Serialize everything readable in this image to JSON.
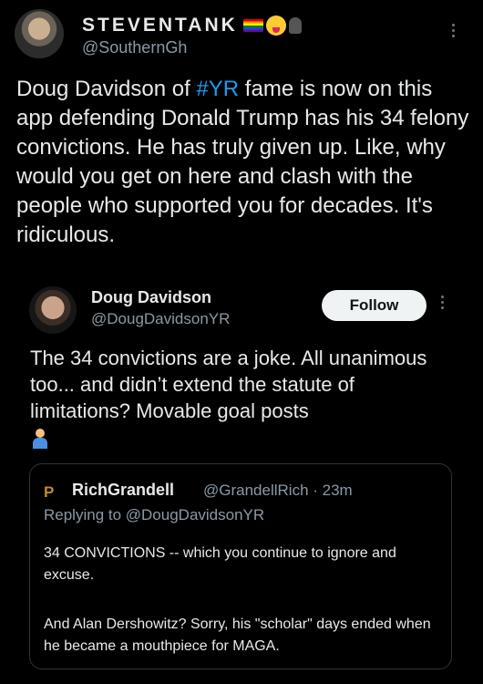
{
  "post": {
    "display_name": "STEVENTANK",
    "handle": "@SouthernGh",
    "text_before_hashtag": "Doug Davidson of ",
    "hashtag": "#YR",
    "text_after_hashtag": " fame is now on this app defending Donald Trump has his 34 felony convictions. He has truly given up. Like, why would you get on here and clash with the people who supported you for decades. It's ridiculous."
  },
  "reply": {
    "display_name": "Doug Davidson",
    "handle": "@DougDavidsonYR",
    "follow_label": "Follow",
    "text": "The 34 convictions are a joke. All unanimous too... and didn’t extend the statute of limitations? Movable goal posts"
  },
  "quoted": {
    "avatar_letter": "P",
    "display_name": "RichGrandell",
    "handle_time": "@GrandellRich · 23m",
    "replying_to": "Replying to @DougDavidsonYR",
    "paragraph1": "34 CONVICTIONS -- which you continue to ignore and excuse.",
    "paragraph2": "And Alan Dershowitz? Sorry, his \"scholar\" days ended when he became a mouthpiece for MAGA."
  },
  "icons": {
    "emoji_flag": "rainbow-flag-icon",
    "emoji_face": "squinting-tongue-face-icon",
    "emoji_speak": "speaking-head-icon",
    "more": "more-options-icon",
    "shrug": "person-shrugging-icon"
  },
  "colors": {
    "background": "#000000",
    "text": "#e7e9ea",
    "secondary": "#8b98a5",
    "link": "#1d9bf0",
    "border": "#2f3336"
  }
}
